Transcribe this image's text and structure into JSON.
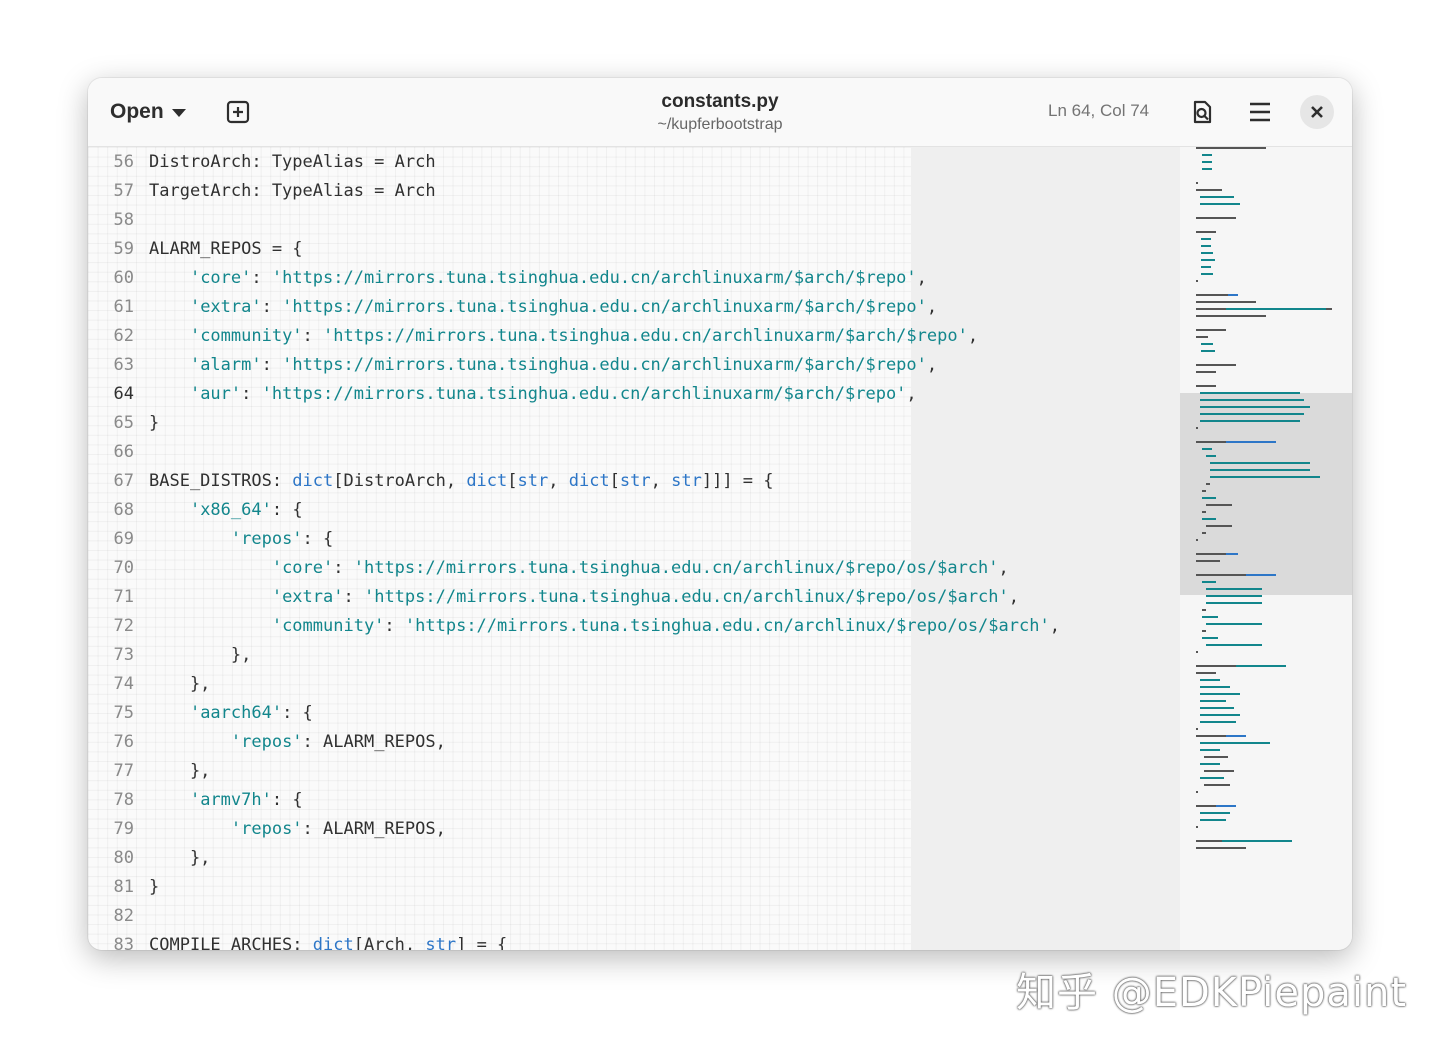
{
  "header": {
    "open_label": "Open",
    "title": "constants.py",
    "subtitle": "~/kupferbootstrap",
    "cursor_position": "Ln 64, Col 74"
  },
  "icons": {
    "new_tab": "plus-square-icon",
    "search": "document-search-icon",
    "menu": "hamburger-menu-icon",
    "close": "close-icon"
  },
  "colors": {
    "string": "#12868c",
    "builtin": "#2d76c7",
    "text": "#303030",
    "line_number": "#8a8a8a"
  },
  "editor": {
    "current_line": 64,
    "lines": [
      {
        "n": "56",
        "t": [
          [
            "",
            "DistroArch: TypeAlias = Arch"
          ]
        ]
      },
      {
        "n": "57",
        "t": [
          [
            "",
            "TargetArch: TypeAlias = Arch"
          ]
        ]
      },
      {
        "n": "58",
        "t": []
      },
      {
        "n": "59",
        "t": [
          [
            "",
            "ALARM_REPOS = {"
          ]
        ]
      },
      {
        "n": "60",
        "t": [
          [
            "",
            "    "
          ],
          [
            "s",
            "'core'"
          ],
          [
            "",
            ": "
          ],
          [
            "s",
            "'https://mirrors.tuna.tsinghua.edu.cn/archlinuxarm/$arch/$repo'"
          ],
          [
            "",
            ","
          ]
        ]
      },
      {
        "n": "61",
        "t": [
          [
            "",
            "    "
          ],
          [
            "s",
            "'extra'"
          ],
          [
            "",
            ": "
          ],
          [
            "s",
            "'https://mirrors.tuna.tsinghua.edu.cn/archlinuxarm/$arch/$repo'"
          ],
          [
            "",
            ","
          ]
        ]
      },
      {
        "n": "62",
        "t": [
          [
            "",
            "    "
          ],
          [
            "s",
            "'community'"
          ],
          [
            "",
            ": "
          ],
          [
            "s",
            "'https://mirrors.tuna.tsinghua.edu.cn/archlinuxarm/$arch/$repo'"
          ],
          [
            "",
            ","
          ]
        ]
      },
      {
        "n": "63",
        "t": [
          [
            "",
            "    "
          ],
          [
            "s",
            "'alarm'"
          ],
          [
            "",
            ": "
          ],
          [
            "s",
            "'https://mirrors.tuna.tsinghua.edu.cn/archlinuxarm/$arch/$repo'"
          ],
          [
            "",
            ","
          ]
        ]
      },
      {
        "n": "64",
        "t": [
          [
            "",
            "    "
          ],
          [
            "s",
            "'aur'"
          ],
          [
            "",
            ": "
          ],
          [
            "s",
            "'https://mirrors.tuna.tsinghua.edu.cn/archlinuxarm/$arch/$repo'"
          ],
          [
            "",
            ","
          ]
        ]
      },
      {
        "n": "65",
        "t": [
          [
            "",
            "}"
          ]
        ]
      },
      {
        "n": "66",
        "t": []
      },
      {
        "n": "67",
        "t": [
          [
            "",
            "BASE_DISTROS: "
          ],
          [
            "b",
            "dict"
          ],
          [
            "",
            "[DistroArch, "
          ],
          [
            "b",
            "dict"
          ],
          [
            "",
            "["
          ],
          [
            "b",
            "str"
          ],
          [
            "",
            ", "
          ],
          [
            "b",
            "dict"
          ],
          [
            "",
            "["
          ],
          [
            "b",
            "str"
          ],
          [
            "",
            ", "
          ],
          [
            "b",
            "str"
          ],
          [
            "",
            "]]] = {"
          ]
        ]
      },
      {
        "n": "68",
        "t": [
          [
            "",
            "    "
          ],
          [
            "s",
            "'x86_64'"
          ],
          [
            "",
            ": {"
          ]
        ]
      },
      {
        "n": "69",
        "t": [
          [
            "",
            "        "
          ],
          [
            "s",
            "'repos'"
          ],
          [
            "",
            ": {"
          ]
        ]
      },
      {
        "n": "70",
        "t": [
          [
            "",
            "            "
          ],
          [
            "s",
            "'core'"
          ],
          [
            "",
            ": "
          ],
          [
            "s",
            "'https://mirrors.tuna.tsinghua.edu.cn/archlinux/$repo/os/$arch'"
          ],
          [
            "",
            ","
          ]
        ]
      },
      {
        "n": "71",
        "t": [
          [
            "",
            "            "
          ],
          [
            "s",
            "'extra'"
          ],
          [
            "",
            ": "
          ],
          [
            "s",
            "'https://mirrors.tuna.tsinghua.edu.cn/archlinux/$repo/os/$arch'"
          ],
          [
            "",
            ","
          ]
        ]
      },
      {
        "n": "72",
        "t": [
          [
            "",
            "            "
          ],
          [
            "s",
            "'community'"
          ],
          [
            "",
            ": "
          ],
          [
            "s",
            "'https://mirrors.tuna.tsinghua.edu.cn/archlinux/$repo/os/$arch'"
          ],
          [
            "",
            ","
          ]
        ]
      },
      {
        "n": "73",
        "t": [
          [
            "",
            "        },"
          ]
        ]
      },
      {
        "n": "74",
        "t": [
          [
            "",
            "    },"
          ]
        ]
      },
      {
        "n": "75",
        "t": [
          [
            "",
            "    "
          ],
          [
            "s",
            "'aarch64'"
          ],
          [
            "",
            ": {"
          ]
        ]
      },
      {
        "n": "76",
        "t": [
          [
            "",
            "        "
          ],
          [
            "s",
            "'repos'"
          ],
          [
            "",
            ": ALARM_REPOS,"
          ]
        ]
      },
      {
        "n": "77",
        "t": [
          [
            "",
            "    },"
          ]
        ]
      },
      {
        "n": "78",
        "t": [
          [
            "",
            "    "
          ],
          [
            "s",
            "'armv7h'"
          ],
          [
            "",
            ": {"
          ]
        ]
      },
      {
        "n": "79",
        "t": [
          [
            "",
            "        "
          ],
          [
            "s",
            "'repos'"
          ],
          [
            "",
            ": ALARM_REPOS,"
          ]
        ]
      },
      {
        "n": "80",
        "t": [
          [
            "",
            "    },"
          ]
        ]
      },
      {
        "n": "81",
        "t": [
          [
            "",
            "}"
          ]
        ]
      },
      {
        "n": "82",
        "t": []
      },
      {
        "n": "83",
        "t": [
          [
            "",
            "COMPILE_ARCHES: "
          ],
          [
            "b",
            "dict"
          ],
          [
            "",
            "[Arch, "
          ],
          [
            "b",
            "str"
          ],
          [
            "",
            "] = {"
          ]
        ]
      }
    ]
  },
  "watermark": "知乎 @EDKPiepaint"
}
